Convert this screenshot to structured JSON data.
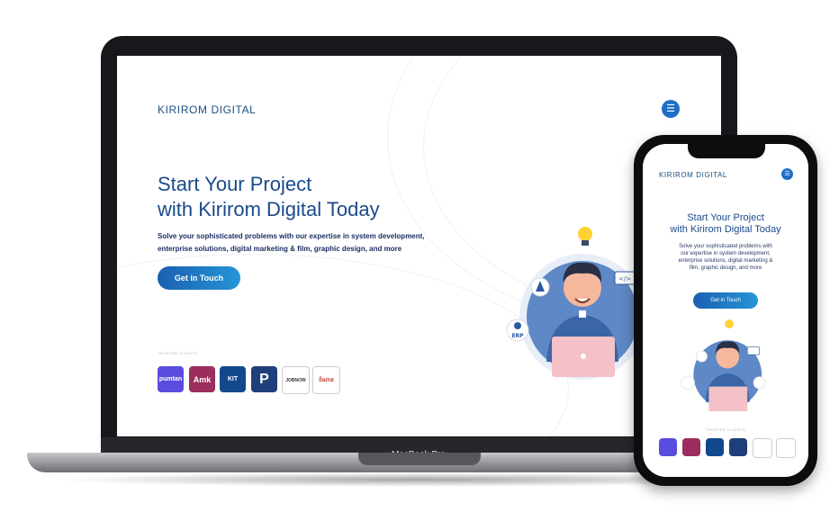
{
  "laptop": {
    "brand": "KIRIROM DIGITAL",
    "menu_icon": "☰",
    "headline_1": "Start Your Project",
    "headline_2": "with Kirirom Digital Today",
    "sub_1": "Solve your sophisticated problems with our expertise in system development,",
    "sub_2": "enterprise solutions, digital marketing & film, graphic design, and more",
    "cta": "Get in Touch",
    "trusted_label": "TRUSTED CLIENTS",
    "clients": [
      {
        "name": "pumtan",
        "color": "#5b4ce0",
        "text": "pumtan"
      },
      {
        "name": "amk",
        "color": "#9b2e5c",
        "text": "Amk"
      },
      {
        "name": "kirirom",
        "color": "#13498c",
        "text": "KIT"
      },
      {
        "name": "p-logo",
        "color": "#1f3f7a",
        "text": "P"
      },
      {
        "name": "job-now",
        "color": "#ffffff",
        "text": "JOBNOW"
      },
      {
        "name": "khmer",
        "color": "#ffffff",
        "text": "ចំណាន"
      }
    ],
    "device_label": "MacBook Pro"
  },
  "phone": {
    "brand": "KIRIROM DIGITAL",
    "headline_1": "Start Your Project",
    "headline_2": "with Kirirom Digital Today",
    "sub_lines": [
      "Solve your sophisticated problems with",
      "our expertise in system development,",
      "enterprise solutions, digital marketing &",
      "film, graphic design, and more"
    ],
    "cta": "Get in Touch",
    "trusted_label": "TRUSTED CLIENTS"
  },
  "illustration": {
    "erp_label": "ERP",
    "code_label": "</>"
  }
}
